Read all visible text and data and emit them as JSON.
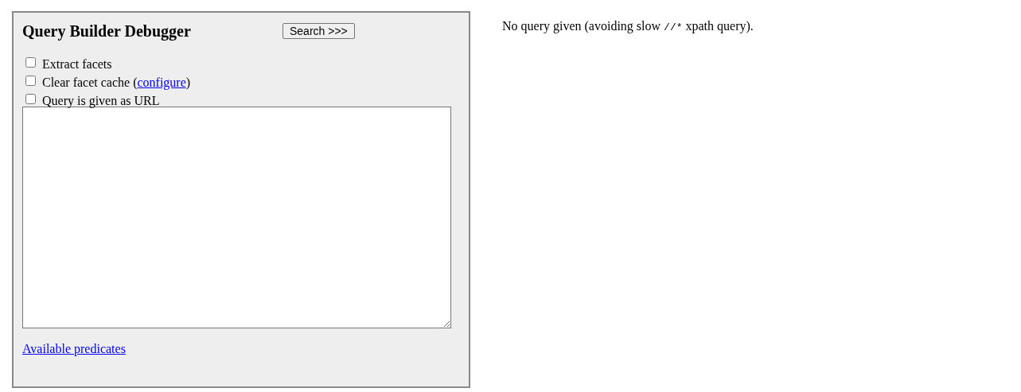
{
  "panel": {
    "title": "Query Builder Debugger",
    "search_button": "Search >>>",
    "options": [
      {
        "label": "Extract facets",
        "checked": false
      },
      {
        "label": "Clear facet cache (",
        "link": "configure",
        "after": ")",
        "checked": false
      },
      {
        "label": "Query is given as URL",
        "checked": false
      }
    ],
    "link": "Available predicates"
  },
  "message": {
    "before": "No query given (avoiding slow ",
    "code": "//*",
    "after": " xpath query)."
  }
}
